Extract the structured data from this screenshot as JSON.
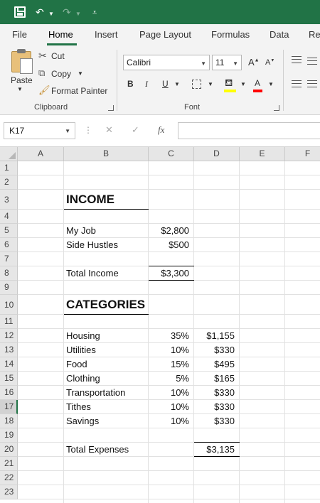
{
  "quick_access": {
    "save_icon": "save-icon",
    "undo_icon": "undo-icon",
    "redo_icon": "redo-icon",
    "customize_icon": "customize-icon"
  },
  "tabs": [
    "File",
    "Home",
    "Insert",
    "Page Layout",
    "Formulas",
    "Data",
    "Re"
  ],
  "active_tab": "Home",
  "accent_color": "#217346",
  "ribbon": {
    "clipboard": {
      "paste_label": "Paste",
      "cut_label": "Cut",
      "copy_label": "Copy",
      "format_painter_label": "Format Painter",
      "group_label": "Clipboard"
    },
    "font": {
      "font_name": "Calibri",
      "font_size": "11",
      "bold_label": "B",
      "italic_label": "I",
      "underline_label": "U",
      "group_label": "Font"
    }
  },
  "formula_bar": {
    "name_box": "K17",
    "fx_label": "fx",
    "formula": ""
  },
  "columns": [
    "A",
    "B",
    "C",
    "D",
    "E",
    "F"
  ],
  "rows": [
    "1",
    "2",
    "3",
    "4",
    "5",
    "6",
    "7",
    "8",
    "9",
    "10",
    "11",
    "12",
    "13",
    "14",
    "15",
    "16",
    "17",
    "18",
    "19",
    "20",
    "21",
    "22",
    "23"
  ],
  "selected_row": "17",
  "sheet": {
    "income_heading": "INCOME",
    "income_items": [
      {
        "label": "My Job",
        "amount": "$2,800"
      },
      {
        "label": "Side Hustles",
        "amount": "$500"
      }
    ],
    "total_income": {
      "label": "Total Income",
      "amount": "$3,300"
    },
    "categories_heading": "CATEGORIES",
    "categories": [
      {
        "label": "Housing",
        "percent": "35%",
        "amount": "$1,155"
      },
      {
        "label": "Utilities",
        "percent": "10%",
        "amount": "$330"
      },
      {
        "label": "Food",
        "percent": "15%",
        "amount": "$495"
      },
      {
        "label": "Clothing",
        "percent": "5%",
        "amount": "$165"
      },
      {
        "label": "Transportation",
        "percent": "10%",
        "amount": "$330"
      },
      {
        "label": "Tithes",
        "percent": "10%",
        "amount": "$330"
      },
      {
        "label": "Savings",
        "percent": "10%",
        "amount": "$330"
      }
    ],
    "total_expenses": {
      "label": "Total Expenses",
      "amount": "$3,135"
    }
  }
}
